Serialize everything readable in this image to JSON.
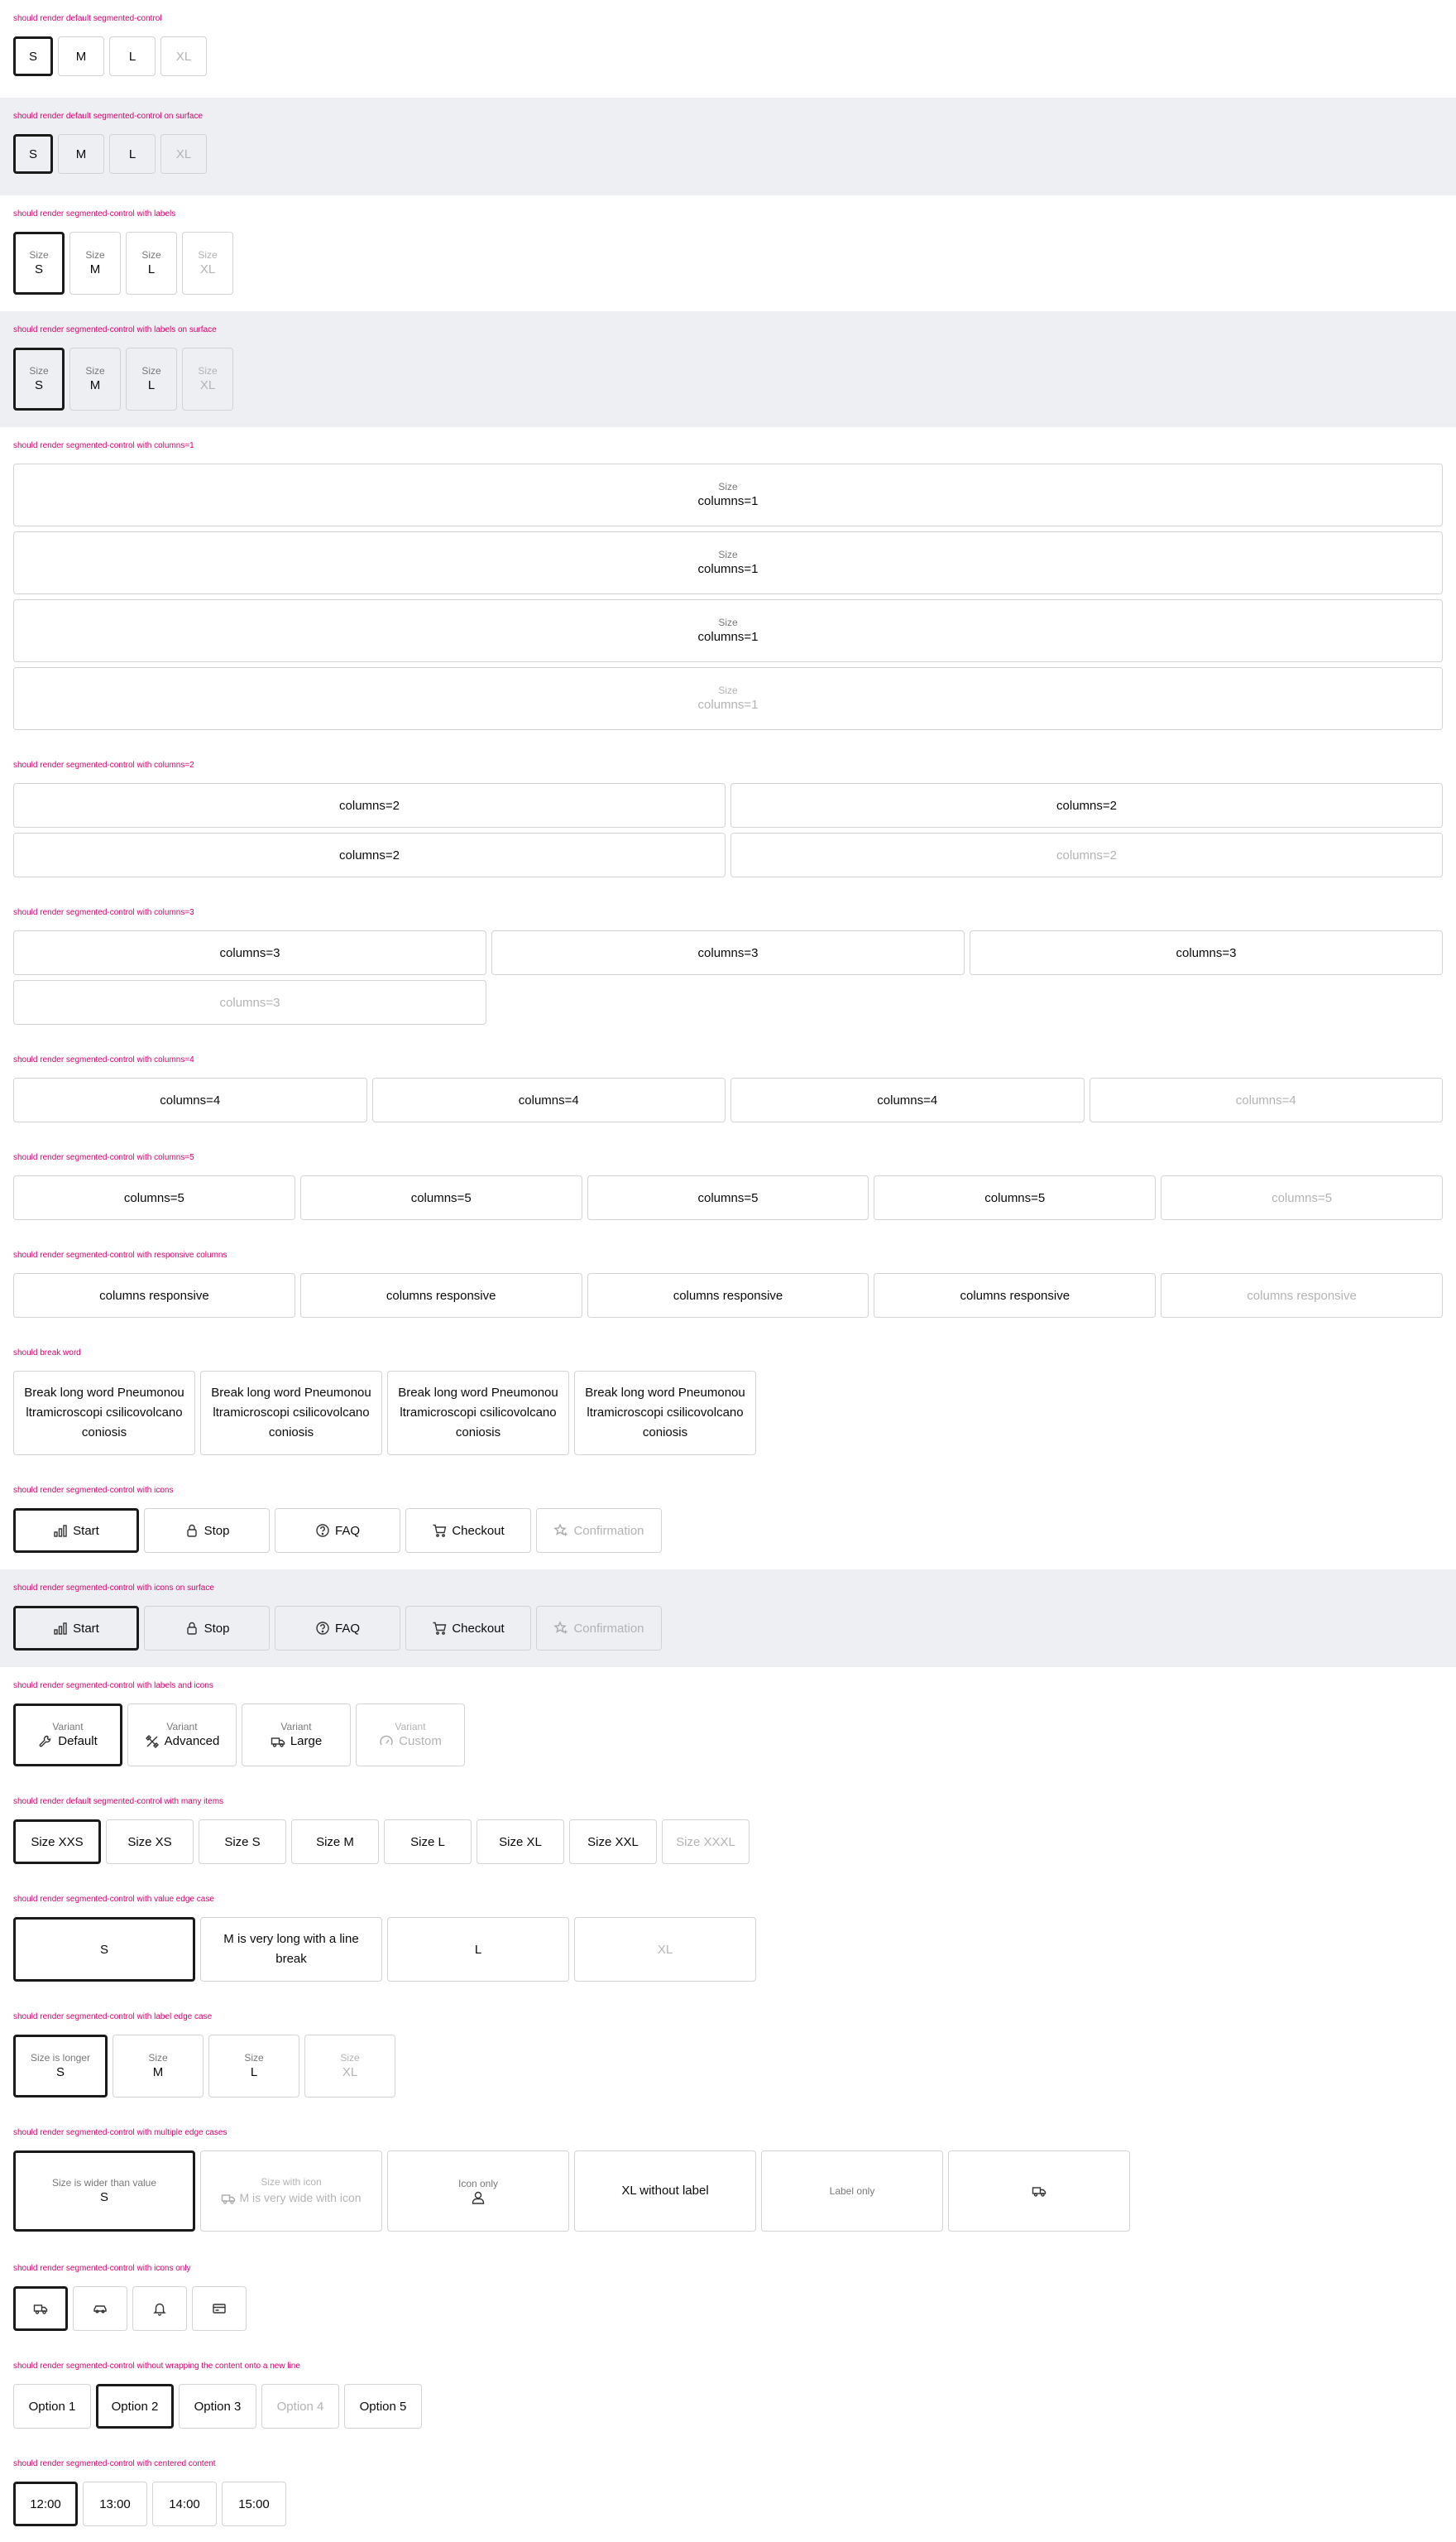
{
  "sections": {
    "default": {
      "title": "should render default segmented-control",
      "items": [
        "S",
        "M",
        "L",
        "XL"
      ]
    },
    "surface": {
      "title": "should render default segmented-control on surface",
      "items": [
        "S",
        "M",
        "L",
        "XL"
      ]
    },
    "labels": {
      "title": "should render segmented-control with labels",
      "label": "Size",
      "items": [
        "S",
        "M",
        "L",
        "XL"
      ]
    },
    "labels_surface": {
      "title": "should render segmented-control with labels on surface",
      "label": "Size",
      "items": [
        "S",
        "M",
        "L",
        "XL"
      ]
    },
    "col1": {
      "title": "should render segmented-control with columns=1",
      "label": "Size",
      "value": "columns=1"
    },
    "col2": {
      "title": "should render segmented-control with columns=2",
      "value": "columns=2"
    },
    "col3": {
      "title": "should render segmented-control with columns=3",
      "value": "columns=3"
    },
    "col4": {
      "title": "should render segmented-control with columns=4",
      "value": "columns=4"
    },
    "col5": {
      "title": "should render segmented-control with columns=5",
      "value": "columns=5"
    },
    "responsive": {
      "title": "should render segmented-control with responsive columns",
      "value": "columns responsive"
    },
    "break": {
      "title": "should break word",
      "value": "Break long word Pneumonoultramicroscopi csilicovolcanoconiosis"
    },
    "icons": {
      "title": "should render segmented-control with icons",
      "items": [
        "Start",
        "Stop",
        "FAQ",
        "Checkout",
        "Confirmation"
      ]
    },
    "icons_surface": {
      "title": "should render segmented-control with icons on surface",
      "items": [
        "Start",
        "Stop",
        "FAQ",
        "Checkout",
        "Confirmation"
      ]
    },
    "labels_icons": {
      "title": "should render segmented-control with labels and icons",
      "label": "Variant",
      "items": [
        "Default",
        "Advanced",
        "Large",
        "Custom"
      ]
    },
    "many": {
      "title": "should render default segmented-control with many items",
      "items": [
        "Size XXS",
        "Size XS",
        "Size S",
        "Size M",
        "Size L",
        "Size XL",
        "Size XXL",
        "Size XXXL"
      ]
    },
    "value_edge": {
      "title": "should render segmented-control with value edge case",
      "items": [
        "S",
        "M is very long with a line break",
        "L",
        "XL"
      ]
    },
    "label_edge": {
      "title": "should render segmented-control with label edge case",
      "labels": [
        "Size is longer",
        "Size",
        "Size",
        "Size"
      ],
      "items": [
        "S",
        "M",
        "L",
        "XL"
      ]
    },
    "multi_edge": {
      "title": "should render segmented-control with multiple edge cases",
      "item1_label": "Size is wider than value",
      "item1_value": "S",
      "item2_label": "Size with icon",
      "item2_value": "M is very wide with icon",
      "item3_label": "Icon only",
      "item4_value": "XL without label",
      "item5_label": "Label only"
    },
    "icons_only": {
      "title": "should render segmented-control with icons only"
    },
    "nowrap": {
      "title": "should render segmented-control without wrapping the content onto a new line",
      "items": [
        "Option 1",
        "Option 2",
        "Option 3",
        "Option 4",
        "Option 5"
      ]
    },
    "centered": {
      "title": "should render segmented-control with centered content",
      "items": [
        "12:00",
        "13:00",
        "14:00",
        "15:00"
      ]
    }
  },
  "colors": {
    "title": "#d5006d",
    "surface": "#eeeff2",
    "selected_border": "#1a1a1a",
    "disabled_text": "#b3b3b3"
  },
  "icons": {
    "start": "bar-chart-icon",
    "stop": "lock-icon",
    "faq": "question-circle-icon",
    "checkout": "shopping-cart-icon",
    "confirmation": "star-sparkle-icon",
    "default": "wrench-icon",
    "advanced": "tools-icon",
    "large": "truck-icon",
    "custom": "gauge-icon",
    "icon_only": "user-icon",
    "car": "car-icon",
    "bell": "bell-icon",
    "card": "credit-card-icon"
  }
}
